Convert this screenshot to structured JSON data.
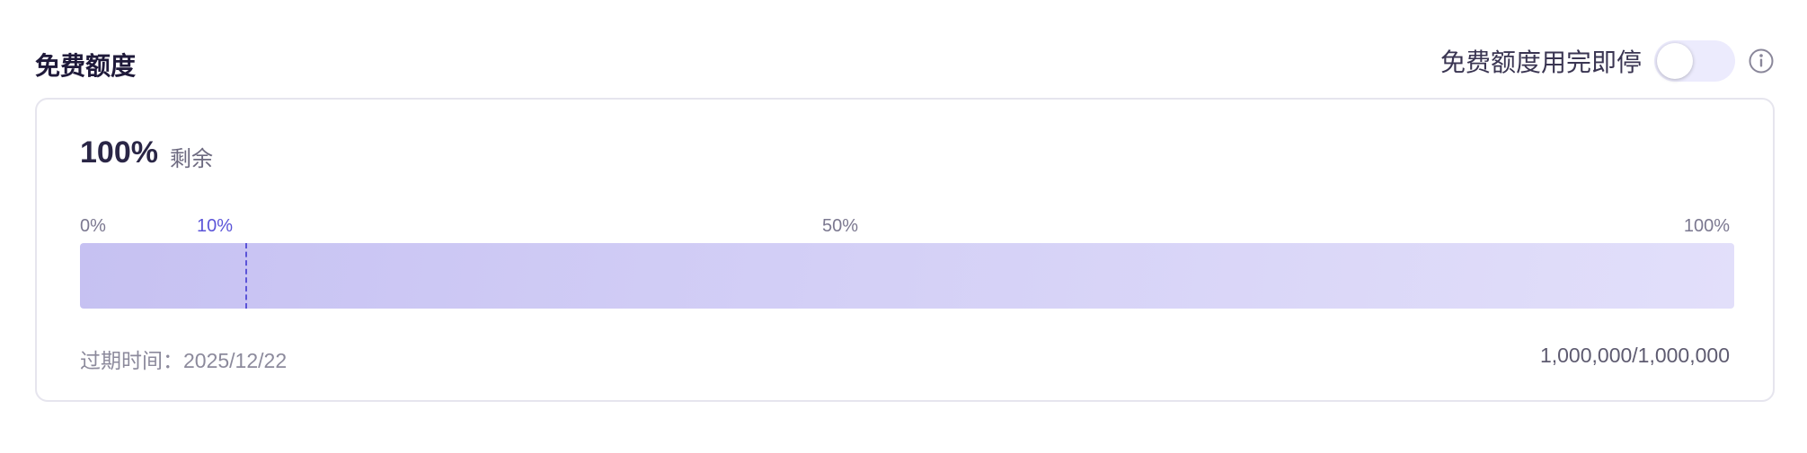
{
  "header": {
    "title": "免费额度",
    "toggle_label": "免费额度用完即停",
    "toggle_on": false
  },
  "quota": {
    "percent": "100%",
    "percent_value": 100,
    "remain_label": "剩余",
    "ticks": {
      "t0": "0%",
      "t10": "10%",
      "t50": "50%",
      "t100": "100%"
    },
    "marker_percent": 10,
    "expire_label": "过期时间：",
    "expire_date": "2025/12/22",
    "usage": "1,000,000/1,000,000"
  },
  "colors": {
    "accent": "#5b54d8",
    "bar_start": "#c6c1f2",
    "bar_end": "#e2dffa"
  },
  "icons": {
    "info": "info-circle-icon"
  }
}
